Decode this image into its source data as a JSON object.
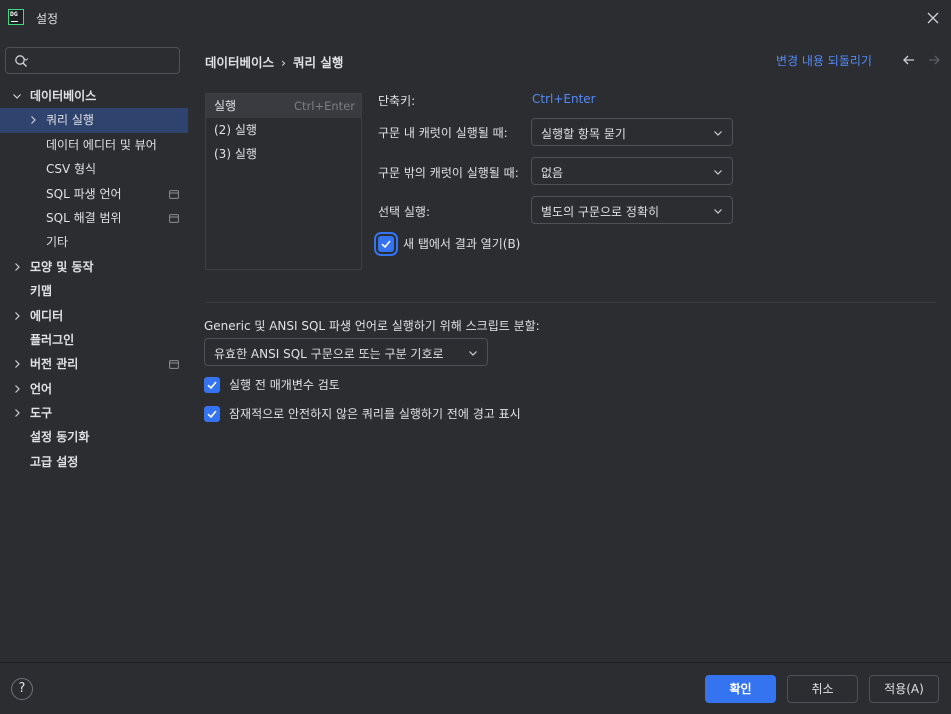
{
  "window": {
    "title": "설정",
    "logo_text": "DG"
  },
  "sidebar": {
    "search": {
      "value": "",
      "placeholder": ""
    },
    "items": [
      {
        "label": "데이터베이스",
        "level": 0,
        "expandable": true,
        "expanded": true,
        "bold": true,
        "selected": false,
        "project_icon": false
      },
      {
        "label": "쿼리 실행",
        "level": 1,
        "expandable": true,
        "expanded": false,
        "bold": false,
        "selected": true,
        "project_icon": false
      },
      {
        "label": "데이터 에디터 및 뷰어",
        "level": 1,
        "expandable": false,
        "bold": false,
        "selected": false,
        "project_icon": false
      },
      {
        "label": "CSV 형식",
        "level": 1,
        "expandable": false,
        "bold": false,
        "selected": false,
        "project_icon": false
      },
      {
        "label": "SQL 파생 언어",
        "level": 1,
        "expandable": false,
        "bold": false,
        "selected": false,
        "project_icon": true
      },
      {
        "label": "SQL 해결 범위",
        "level": 1,
        "expandable": false,
        "bold": false,
        "selected": false,
        "project_icon": true
      },
      {
        "label": "기타",
        "level": 1,
        "expandable": false,
        "bold": false,
        "selected": false,
        "project_icon": false
      },
      {
        "label": "모양 및 동작",
        "level": 0,
        "expandable": true,
        "expanded": false,
        "bold": true,
        "selected": false,
        "project_icon": false
      },
      {
        "label": "키맵",
        "level": 0,
        "expandable": false,
        "bold": true,
        "selected": false,
        "project_icon": false
      },
      {
        "label": "에디터",
        "level": 0,
        "expandable": true,
        "expanded": false,
        "bold": true,
        "selected": false,
        "project_icon": false
      },
      {
        "label": "플러그인",
        "level": 0,
        "expandable": false,
        "bold": true,
        "selected": false,
        "project_icon": false
      },
      {
        "label": "버전 관리",
        "level": 0,
        "expandable": true,
        "expanded": false,
        "bold": true,
        "selected": false,
        "project_icon": true
      },
      {
        "label": "언어",
        "level": 0,
        "expandable": true,
        "expanded": false,
        "bold": true,
        "selected": false,
        "project_icon": false
      },
      {
        "label": "도구",
        "level": 0,
        "expandable": true,
        "expanded": false,
        "bold": true,
        "selected": false,
        "project_icon": false
      },
      {
        "label": "설정 동기화",
        "level": 0,
        "expandable": false,
        "bold": true,
        "selected": false,
        "project_icon": false
      },
      {
        "label": "고급 설정",
        "level": 0,
        "expandable": false,
        "bold": true,
        "selected": false,
        "project_icon": false
      }
    ]
  },
  "header": {
    "breadcrumb": [
      "데이터베이스",
      "쿼리 실행"
    ],
    "breadcrumb_sep": "›",
    "revert_link": "변경 내용 되돌리기"
  },
  "actions": [
    {
      "label": "실행",
      "shortcut": "Ctrl+Enter",
      "selected": true
    },
    {
      "label": "(2) 실행",
      "shortcut": "",
      "selected": false
    },
    {
      "label": "(3) 실행",
      "shortcut": "",
      "selected": false
    }
  ],
  "form": {
    "shortcut_label": "단축키:",
    "shortcut_value": "Ctrl+Enter",
    "caret_inside_label": "구문 내 캐럿이 실행될 때:",
    "caret_inside_value": "실행할 항목 묻기",
    "caret_outside_label": "구문 밖의 캐럿이 실행될 때:",
    "caret_outside_value": "없음",
    "selection_label": "선택 실행:",
    "selection_value": "별도의 구문으로 정확히",
    "new_tab_label": "새 탭에서 결과 열기(B)",
    "new_tab_checked": true
  },
  "script_split": {
    "label": "Generic 및 ANSI SQL 파생 언어로 실행하기 위해 스크립트 분할:",
    "value": "유효한 ANSI SQL 구문으로 또는 구분 기호로"
  },
  "options": [
    {
      "label": "실행 전 매개변수 검토",
      "checked": true
    },
    {
      "label": "잠재적으로 안전하지 않은 쿼리를 실행하기 전에 경고 표시",
      "checked": true
    }
  ],
  "footer": {
    "help": "?",
    "ok": "확인",
    "cancel": "취소",
    "apply": "적용(A)"
  },
  "colors": {
    "background": "#2b2d30",
    "accent": "#3574f0",
    "link": "#548af7",
    "selection": "#2e436e",
    "text": "#dfe1e5"
  },
  "icons": [
    "close-icon",
    "search-icon",
    "chevron-down-icon",
    "chevron-right-icon",
    "project-scope-icon",
    "arrow-left-icon",
    "arrow-right-icon",
    "check-icon",
    "help-icon"
  ]
}
